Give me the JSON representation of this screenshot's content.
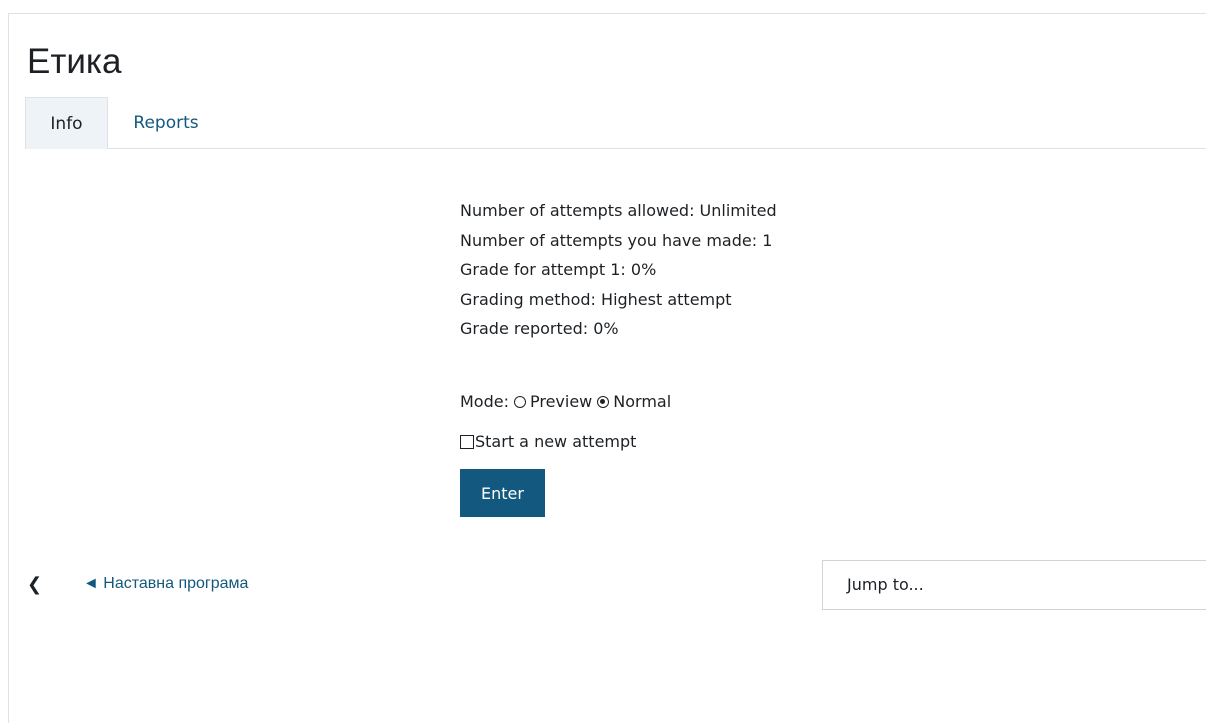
{
  "page": {
    "title": "Етика"
  },
  "tabs": [
    {
      "label": "Info",
      "active": true
    },
    {
      "label": "Reports",
      "active": false
    }
  ],
  "info": {
    "lines": [
      "Number of attempts allowed: Unlimited",
      "Number of attempts you have made: 1",
      "Grade for attempt 1: 0%",
      "Grading method: Highest attempt",
      "Grade reported: 0%"
    ]
  },
  "mode": {
    "label": "Mode:",
    "options": [
      {
        "label": "Preview",
        "selected": false
      },
      {
        "label": "Normal",
        "selected": true
      }
    ]
  },
  "new_attempt": {
    "label": "Start a new attempt",
    "checked": false
  },
  "enter_button": {
    "label": "Enter"
  },
  "navigation": {
    "prev_link": "◄ Наставна програма",
    "jump_placeholder": "Jump to..."
  },
  "colors": {
    "accent": "#13587e",
    "active_tab_bg": "#eef3f7",
    "border": "#dee2e6"
  }
}
